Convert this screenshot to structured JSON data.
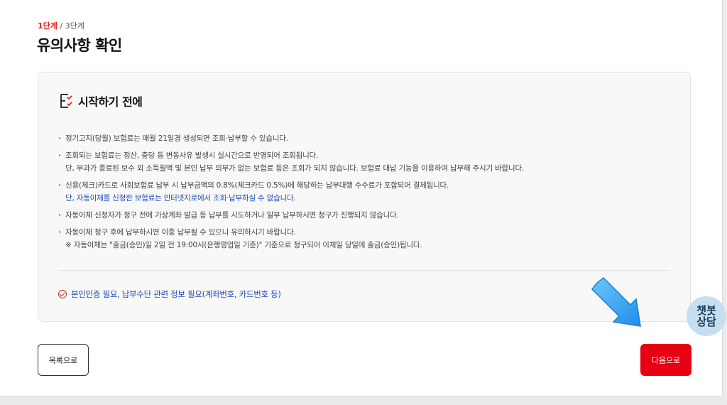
{
  "step": {
    "current": "1단계",
    "separator": " / ",
    "total": "3단계"
  },
  "title": "유의사항 확인",
  "card": {
    "icon": "checklist-icon",
    "heading": "시작하기 전에",
    "notes": [
      {
        "lines": [
          "정기고지(당월) 보험료는 매월 21일경 생성되면 조회·납부할 수 있습니다."
        ]
      },
      {
        "lines": [
          "조회되는 보험료는 정산, 충당 등 변동사유 발생시 실시간으로 반영되어 조회됩니다.",
          "단, 부과가 종료된 보수 외 소득월액 및 본인 납무 의무가 없는 보험료 등은 조회가 되지 않습니다. 보험료 대납 기능을 이용하여 납부해 주시기 바랍니다."
        ]
      },
      {
        "lines": [
          "신용(체크)카드로 사회보험료 납부 시 납부금액의 0.8%(체크카드 0.5%)에 해당하는 납부대행 수수료가 포함되어 결제됩니다."
        ],
        "blue_line": "단, 자동이체를 신청한 보험료는 인터넷지로에서 조회·납부하실 수 없습니다."
      },
      {
        "lines": [
          "자동이체 신청자가 청구 전에 가상계좌 발급 등 납부를 시도하거나 일부 납부하시면 청구가 진행되지 않습니다."
        ]
      },
      {
        "lines": [
          "자동이체 청구 후에 납부하시면 이중 납부될 수 있으니 유의하시기 바랍니다.",
          "※ 자동이체는 \"출금(승인)일 2일 전 19:00시(은행영업일 기준)\" 기준으로 청구되어 이체일 당일에 출금(승인)됩니다."
        ]
      }
    ],
    "requirement": "본인인증 필요, 납부수단 관련 정보 필요(계좌번호, 카드번호 등)"
  },
  "buttons": {
    "list": "목록으로",
    "next": "다음으로"
  },
  "chatbot": {
    "line1": "챗봇",
    "line2": "상담"
  },
  "colors": {
    "accent": "#e60012",
    "link_blue": "#1e4bb8",
    "arrow_blue": "#2a9ff0"
  }
}
